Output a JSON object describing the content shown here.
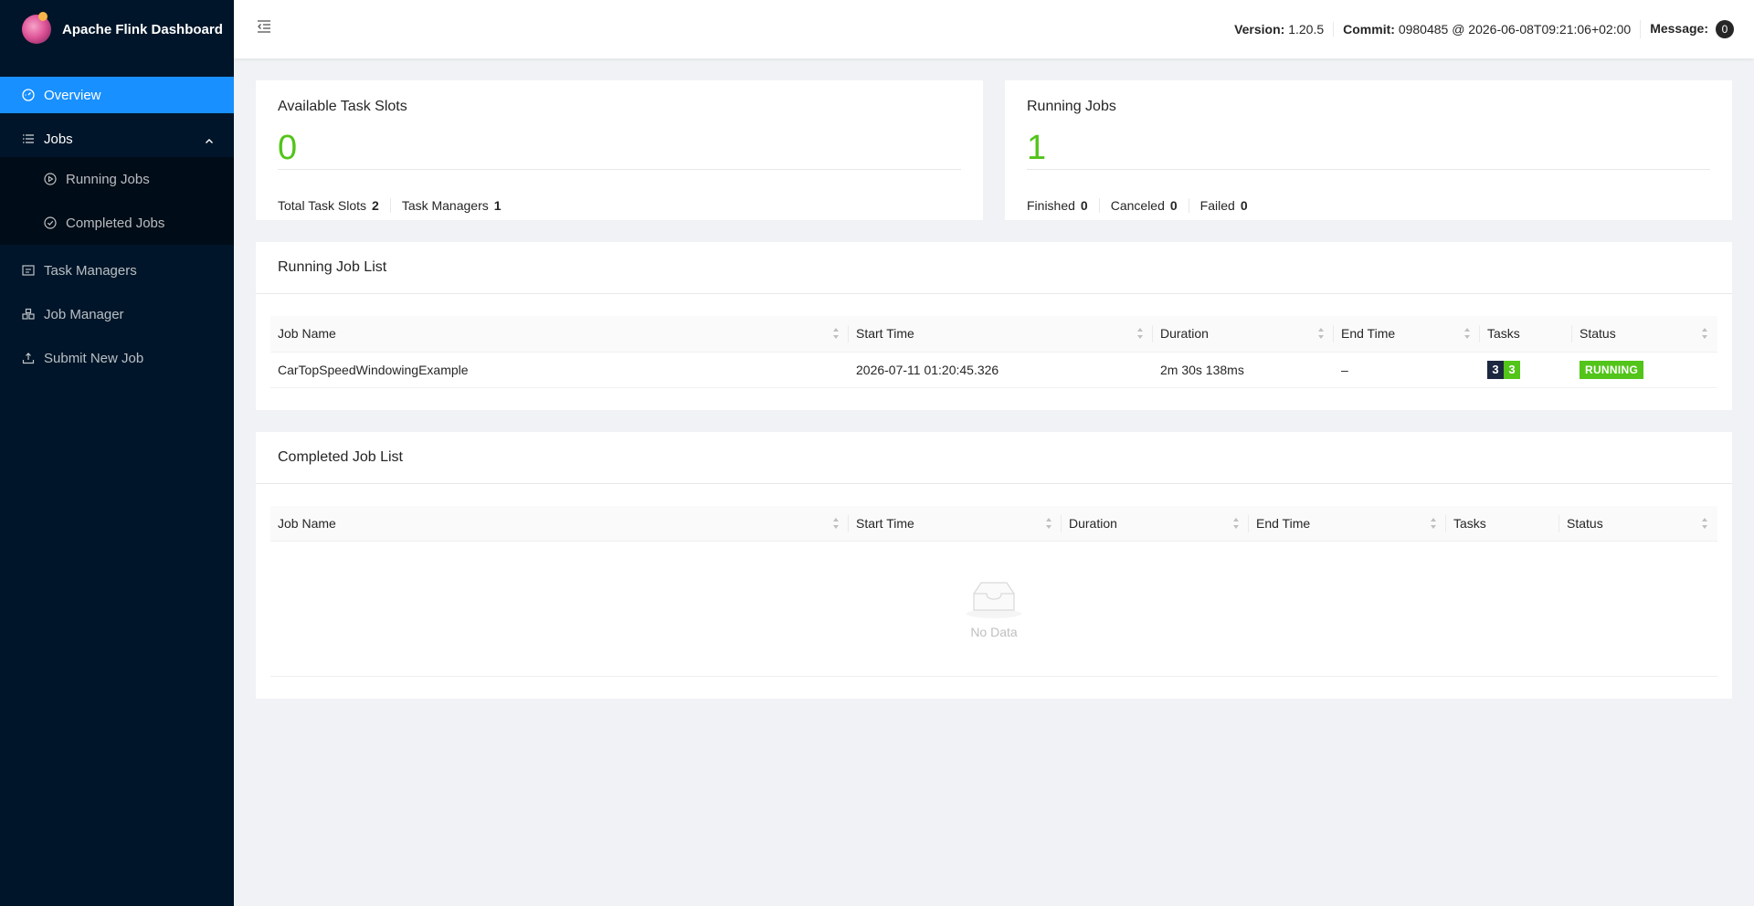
{
  "app": {
    "title": "Apache Flink Dashboard"
  },
  "sidebar": {
    "overview": "Overview",
    "jobs": "Jobs",
    "running_jobs": "Running Jobs",
    "completed_jobs": "Completed Jobs",
    "task_managers": "Task Managers",
    "job_manager": "Job Manager",
    "submit_new_job": "Submit New Job"
  },
  "header": {
    "version_label": "Version:",
    "version_value": "1.20.5",
    "commit_label": "Commit:",
    "commit_value": "0980485 @ 2026-06-08T09:21:06+02:00",
    "message_label": "Message:",
    "message_count": "0"
  },
  "slots": {
    "title": "Available Task Slots",
    "value": "0",
    "total_label": "Total Task Slots",
    "total_value": "2",
    "tm_label": "Task Managers",
    "tm_value": "1"
  },
  "running": {
    "title": "Running Jobs",
    "value": "1",
    "finished_label": "Finished",
    "finished_value": "0",
    "canceled_label": "Canceled",
    "canceled_value": "0",
    "failed_label": "Failed",
    "failed_value": "0"
  },
  "running_list": {
    "title": "Running Job List",
    "columns": {
      "name": "Job Name",
      "start": "Start Time",
      "duration": "Duration",
      "end": "End Time",
      "tasks": "Tasks",
      "status": "Status"
    },
    "rows": [
      {
        "name": "CarTopSpeedWindowingExample",
        "start": "2026-07-11 01:20:45.326",
        "duration": "2m 30s 138ms",
        "end": "–",
        "tasks_total": "3",
        "tasks_running": "3",
        "status": "RUNNING"
      }
    ]
  },
  "completed_list": {
    "title": "Completed Job List",
    "columns": {
      "name": "Job Name",
      "start": "Start Time",
      "duration": "Duration",
      "end": "End Time",
      "tasks": "Tasks",
      "status": "Status"
    },
    "empty_text": "No Data"
  },
  "colors": {
    "sidebar": "#001529",
    "accent": "#1890ff",
    "success": "#52c41a"
  },
  "icons": [
    "dashboard-icon",
    "list-icon",
    "play-circle-icon",
    "check-circle-icon",
    "task-manager-icon",
    "job-manager-icon",
    "upload-icon",
    "menu-fold-icon",
    "inbox-icon"
  ]
}
